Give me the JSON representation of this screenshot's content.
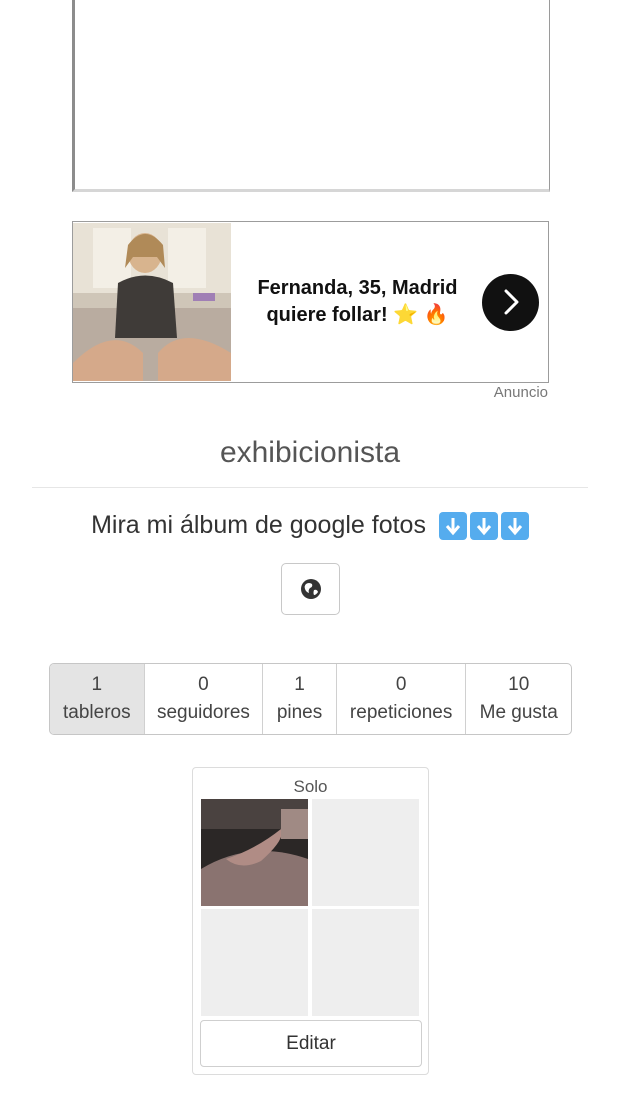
{
  "ad": {
    "headline_line1": "Fernanda, 35, Madrid",
    "headline_line2": "quiere follar! ⭐ 🔥",
    "label": "Anuncio",
    "image_icon": "ad-photo",
    "arrow_icon": "chevron-right-icon"
  },
  "profile": {
    "username": "exhibicionista",
    "bio": "Mira mi álbum de google fotos",
    "bio_emoji": [
      "down-arrow-button-icon",
      "down-arrow-button-icon",
      "down-arrow-button-icon"
    ],
    "website_icon": "globe-icon"
  },
  "stats": [
    {
      "count": "1",
      "label": "tableros",
      "selected": true
    },
    {
      "count": "0",
      "label": "seguidores",
      "selected": false
    },
    {
      "count": "1",
      "label": "pines",
      "selected": false
    },
    {
      "count": "0",
      "label": "repeticiones",
      "selected": false
    },
    {
      "count": "10",
      "label": "Me gusta",
      "selected": false
    }
  ],
  "board": {
    "title": "Solo",
    "edit_label": "Editar"
  }
}
